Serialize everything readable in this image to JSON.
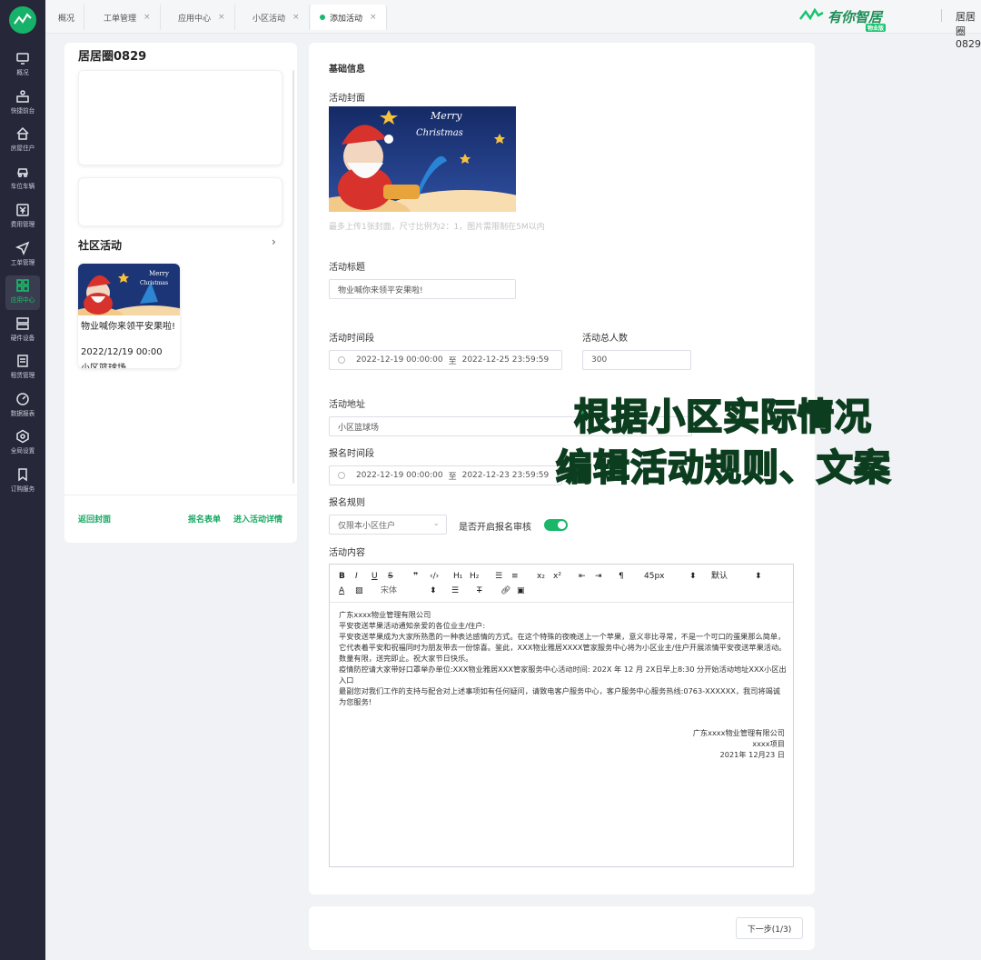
{
  "sidebar": {
    "items": [
      {
        "label": "概况",
        "icon": "monitor-icon"
      },
      {
        "label": "快捷前台",
        "icon": "reception-icon"
      },
      {
        "label": "房屋住户",
        "icon": "house-icon"
      },
      {
        "label": "车位车辆",
        "icon": "car-icon"
      },
      {
        "label": "费用管理",
        "icon": "yen-icon"
      },
      {
        "label": "工单管理",
        "icon": "send-icon"
      },
      {
        "label": "应用中心",
        "icon": "apps-icon"
      },
      {
        "label": "硬件设备",
        "icon": "server-icon"
      },
      {
        "label": "租赁管理",
        "icon": "document-icon"
      },
      {
        "label": "数据报表",
        "icon": "gauge-icon"
      },
      {
        "label": "全局设置",
        "icon": "settings-icon"
      },
      {
        "label": "订购服务",
        "icon": "bookmark-icon"
      }
    ],
    "active_index": 6
  },
  "tabs": [
    {
      "label": "概况",
      "closable": false
    },
    {
      "label": "工单管理",
      "closable": true
    },
    {
      "label": "应用中心",
      "closable": true
    },
    {
      "label": "小区活动",
      "closable": true
    },
    {
      "label": "添加活动",
      "closable": true
    }
  ],
  "brand": {
    "name": "有你智居",
    "tag": "物业版"
  },
  "user": {
    "name": "居居圈0829"
  },
  "preview": {
    "title": "居居圈0829",
    "section": "社区活动",
    "activity": {
      "title": "物业喊你来领平安果啦!",
      "date": "2022/12/19 00:00",
      "location": "小区篮球场"
    },
    "links": {
      "cover": "返回封面",
      "form": "报名表单",
      "detail": "进入活动详情"
    }
  },
  "form": {
    "section_title": "基础信息",
    "cover_label": "活动封面",
    "cover_hint": "最多上传1张封面，尺寸比例为2：1，图片需限制在5M以内",
    "cover_text": {
      "line1": "Merry",
      "line2": "Christmas"
    },
    "title_label": "活动标题",
    "title_value": "物业喊你来领平安果啦!",
    "time_label": "活动时间段",
    "time_start": "2022-12-19 00:00:00",
    "time_to": "至",
    "time_end": "2022-12-25 23:59:59",
    "count_label": "活动总人数",
    "count_value": "300",
    "address_label": "活动地址",
    "address_value": "小区篮球场",
    "signup_time_label": "报名时间段",
    "signup_start": "2022-12-19 00:00:00",
    "signup_end": "2022-12-23 23:59:59",
    "rule_label": "报名规则",
    "rule_value": "仅限本小区住户",
    "review_label": "是否开启报名审核",
    "review_enabled": true,
    "content_label": "活动内容"
  },
  "editor": {
    "font_size": "45px",
    "paragraph": "默认",
    "font_family": "宋体",
    "lines": [
      "广东xxxx物业管理有限公司",
      "平安夜送苹果活动通知亲爱的各位业主/住户:",
      "平安夜送苹果成为大家所熟悉的一种表达感情的方式。在这个特殊的夜晚送上一个苹果，意义非比寻常，不是一个可口的蛋果那么简单，它代表着平安和祝福同时为朋友带去一份惊喜。鉴此，XXX物业雅居XXXX管家服务中心将为小区业主/住户开展浓情平安夜送苹果活动。数量有限，送完即止。祝大家节日快乐。",
      "疫情防控请大家带好口罩举办单位:XXX物业雅居XXX管家服务中心活动时间: 202X 年 12 月 2X日早上8:30 分开始活动地址XXX小区出入口",
      "最副您对我们工作的支持与配合对上述事项如有任何疑问，请致电客户服务中心，客户服务中心服务热线:0763-XXXXXX，我司将竭诚为您服务!"
    ],
    "signature": [
      "广东xxxx物业管理有限公司",
      "xxxx项目",
      "2021年 12月23 日"
    ]
  },
  "footer": {
    "next_button": "下一步(1/3)"
  },
  "overlay": {
    "line1": "根据小区实际情况",
    "line2": "编辑活动规则、文案"
  },
  "colors": {
    "accent": "#19b767",
    "sidebar_bg": "#26283a"
  }
}
